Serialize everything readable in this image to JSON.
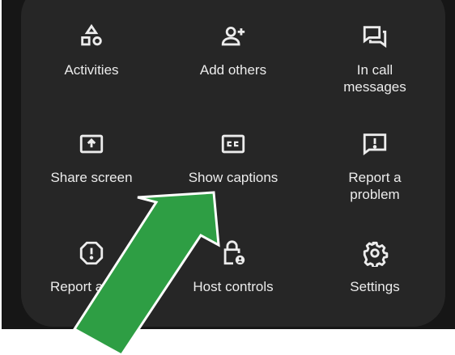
{
  "menu": {
    "items": [
      {
        "label": "Activities",
        "icon": "shapes-icon"
      },
      {
        "label": "Add others",
        "icon": "add-person-icon"
      },
      {
        "label": "In call\nmessages",
        "icon": "chat-icon"
      },
      {
        "label": "Share screen",
        "icon": "share-screen-icon"
      },
      {
        "label": "Show captions",
        "icon": "closed-captions-icon"
      },
      {
        "label": "Report a\nproblem",
        "icon": "report-problem-icon"
      },
      {
        "label": "Report abuse",
        "icon": "report-abuse-icon"
      },
      {
        "label": "Host controls",
        "icon": "lock-person-icon"
      },
      {
        "label": "Settings",
        "icon": "gear-icon"
      }
    ]
  },
  "annotation": {
    "arrow_color": "#2e9e44",
    "arrow_border": "#ffffff",
    "target": "Show captions"
  },
  "theme": {
    "panel_bg": "#262626",
    "backdrop_bg": "#161616",
    "text_color": "#ececec"
  }
}
